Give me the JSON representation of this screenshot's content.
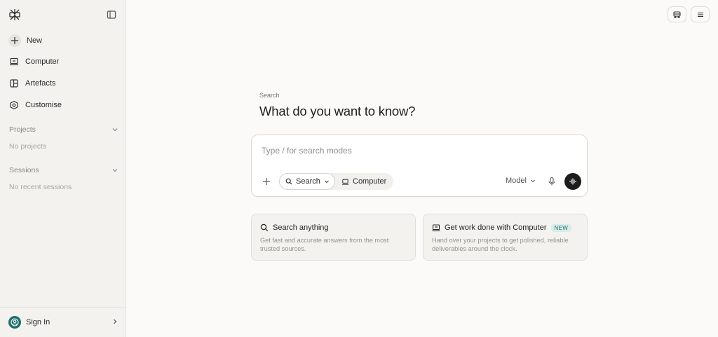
{
  "sidebar": {
    "new_label": "New",
    "computer_label": "Computer",
    "artefacts_label": "Artefacts",
    "customise_label": "Customise",
    "projects": {
      "title": "Projects",
      "empty": "No projects"
    },
    "sessions": {
      "title": "Sessions",
      "empty": "No recent sessions"
    },
    "sign_in_label": "Sign In"
  },
  "main": {
    "label": "Search",
    "headline": "What do you want to know?",
    "query": {
      "value": "",
      "placeholder": "Type / for search modes"
    },
    "modes": {
      "search": "Search",
      "computer": "Computer"
    },
    "model_label": "Model"
  },
  "cards": [
    {
      "title": "Search anything",
      "description": "Get fast and accurate answers from the most trusted sources."
    },
    {
      "title": "Get work done with Computer",
      "badge": "NEW",
      "description": "Hand over your projects to get polished, reliable deliverables around the clock."
    }
  ],
  "icons": {
    "logo": "logo-icon",
    "collapse": "sidebar-toggle-icon",
    "new": "plus-icon",
    "computer": "laptop-icon",
    "artefacts": "artefacts-icon",
    "customise": "settings-hex-icon",
    "signin": "user-icon",
    "search": "search-icon",
    "mic": "mic-icon",
    "voice": "waveform-icon",
    "top_app": "car-icon",
    "top_menu": "menu-icon"
  },
  "colors": {
    "background": "#fbfaf8",
    "sidebar": "#f3f2ef",
    "accent": "#1f6e6a",
    "voice_button": "#1d1d1d"
  }
}
